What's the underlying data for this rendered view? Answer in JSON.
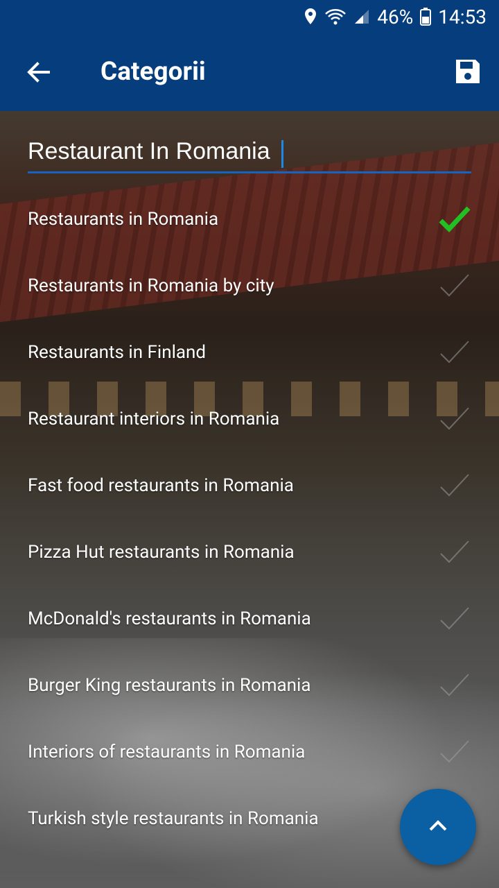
{
  "status_bar": {
    "battery_percent": "46%",
    "time": "14:53",
    "icons": [
      "location-icon",
      "wifi-icon",
      "signal-icon",
      "battery-icon"
    ]
  },
  "app_bar": {
    "title": "Categorii",
    "back_icon": "arrow-back-icon",
    "save_icon": "save-icon",
    "color": "#063d7c"
  },
  "search": {
    "value": "Restaurant In Romania"
  },
  "categories": [
    {
      "label": "Restaurants in Romania",
      "checked": true
    },
    {
      "label": "Restaurants in Romania by city",
      "checked": false
    },
    {
      "label": "Restaurants in Finland",
      "checked": false
    },
    {
      "label": "Restaurant interiors in Romania",
      "checked": false
    },
    {
      "label": "Fast food restaurants in Romania",
      "checked": false
    },
    {
      "label": "Pizza Hut restaurants in Romania",
      "checked": false
    },
    {
      "label": "McDonald's restaurants in Romania",
      "checked": false
    },
    {
      "label": "Burger King restaurants in Romania",
      "checked": false
    },
    {
      "label": "Interiors of restaurants in Romania",
      "checked": false
    },
    {
      "label": "Turkish style restaurants in Romania",
      "checked": false
    }
  ],
  "fab": {
    "icon": "chevron-up-icon",
    "color": "#0b5fa3"
  },
  "colors": {
    "checked": "#22c022",
    "unchecked": "#9e9e9e",
    "accent": "#1565c0"
  }
}
